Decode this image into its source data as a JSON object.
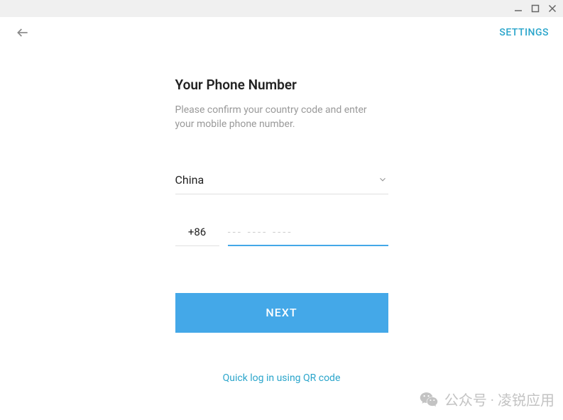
{
  "topbar": {
    "settings_label": "SETTINGS"
  },
  "form": {
    "title": "Your Phone Number",
    "subtitle": "Please confirm your country code and enter your mobile phone number.",
    "country": "China",
    "country_code": "+86",
    "phone_value": "",
    "phone_placeholder": "--- ---- ----",
    "next_label": "NEXT",
    "qr_link_label": "Quick log in using QR code"
  },
  "watermark": {
    "text": "公众号 · 凌锐应用"
  }
}
